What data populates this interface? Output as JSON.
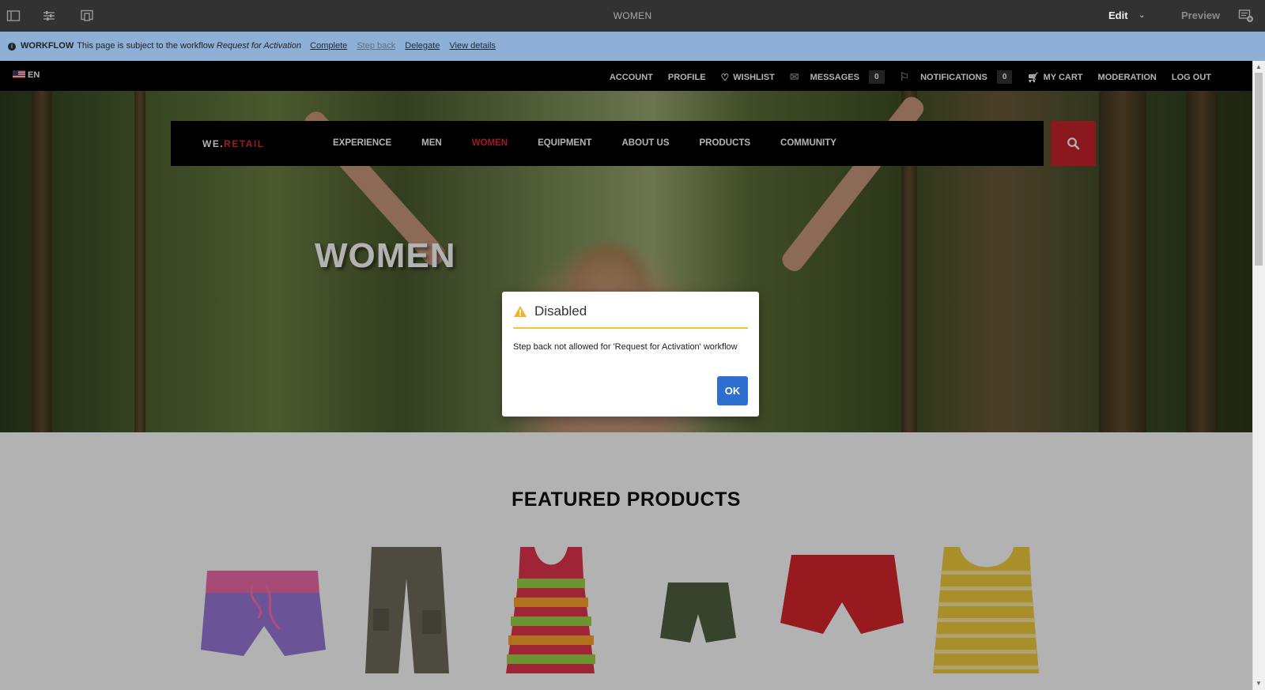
{
  "editor": {
    "page_title": "WOMEN",
    "mode_label": "Edit",
    "preview_label": "Preview"
  },
  "workflow": {
    "label": "WORKFLOW",
    "message": "This page is subject to the workflow",
    "workflow_name": "Request for Activation",
    "links": {
      "complete": "Complete",
      "step_back": "Step back",
      "delegate": "Delegate",
      "view_details": "View details"
    }
  },
  "site_header": {
    "language": "EN",
    "account": "ACCOUNT",
    "profile": "PROFILE",
    "wishlist": "WISHLIST",
    "messages": "MESSAGES",
    "messages_count": "0",
    "notifications": "NOTIFICATIONS",
    "notifications_count": "0",
    "my_cart": "MY CART",
    "moderation": "MODERATION",
    "log_out": "LOG OUT"
  },
  "nav": {
    "logo_prefix": "WE.",
    "logo_suffix": "RETAIL",
    "items": [
      "EXPERIENCE",
      "MEN",
      "WOMEN",
      "EQUIPMENT",
      "ABOUT US",
      "PRODUCTS",
      "COMMUNITY"
    ],
    "active": "WOMEN"
  },
  "hero": {
    "title": "WOMEN"
  },
  "featured": {
    "title": "FEATURED PRODUCTS"
  },
  "dialog": {
    "title": "Disabled",
    "message": "Step back not allowed for 'Request for Activation' workflow",
    "ok_label": "OK"
  },
  "colors": {
    "accent_red": "#e4262d",
    "workflow_bar": "#8eb0d6",
    "dialog_ok": "#2d6fd0",
    "warning": "#f3c33a"
  }
}
